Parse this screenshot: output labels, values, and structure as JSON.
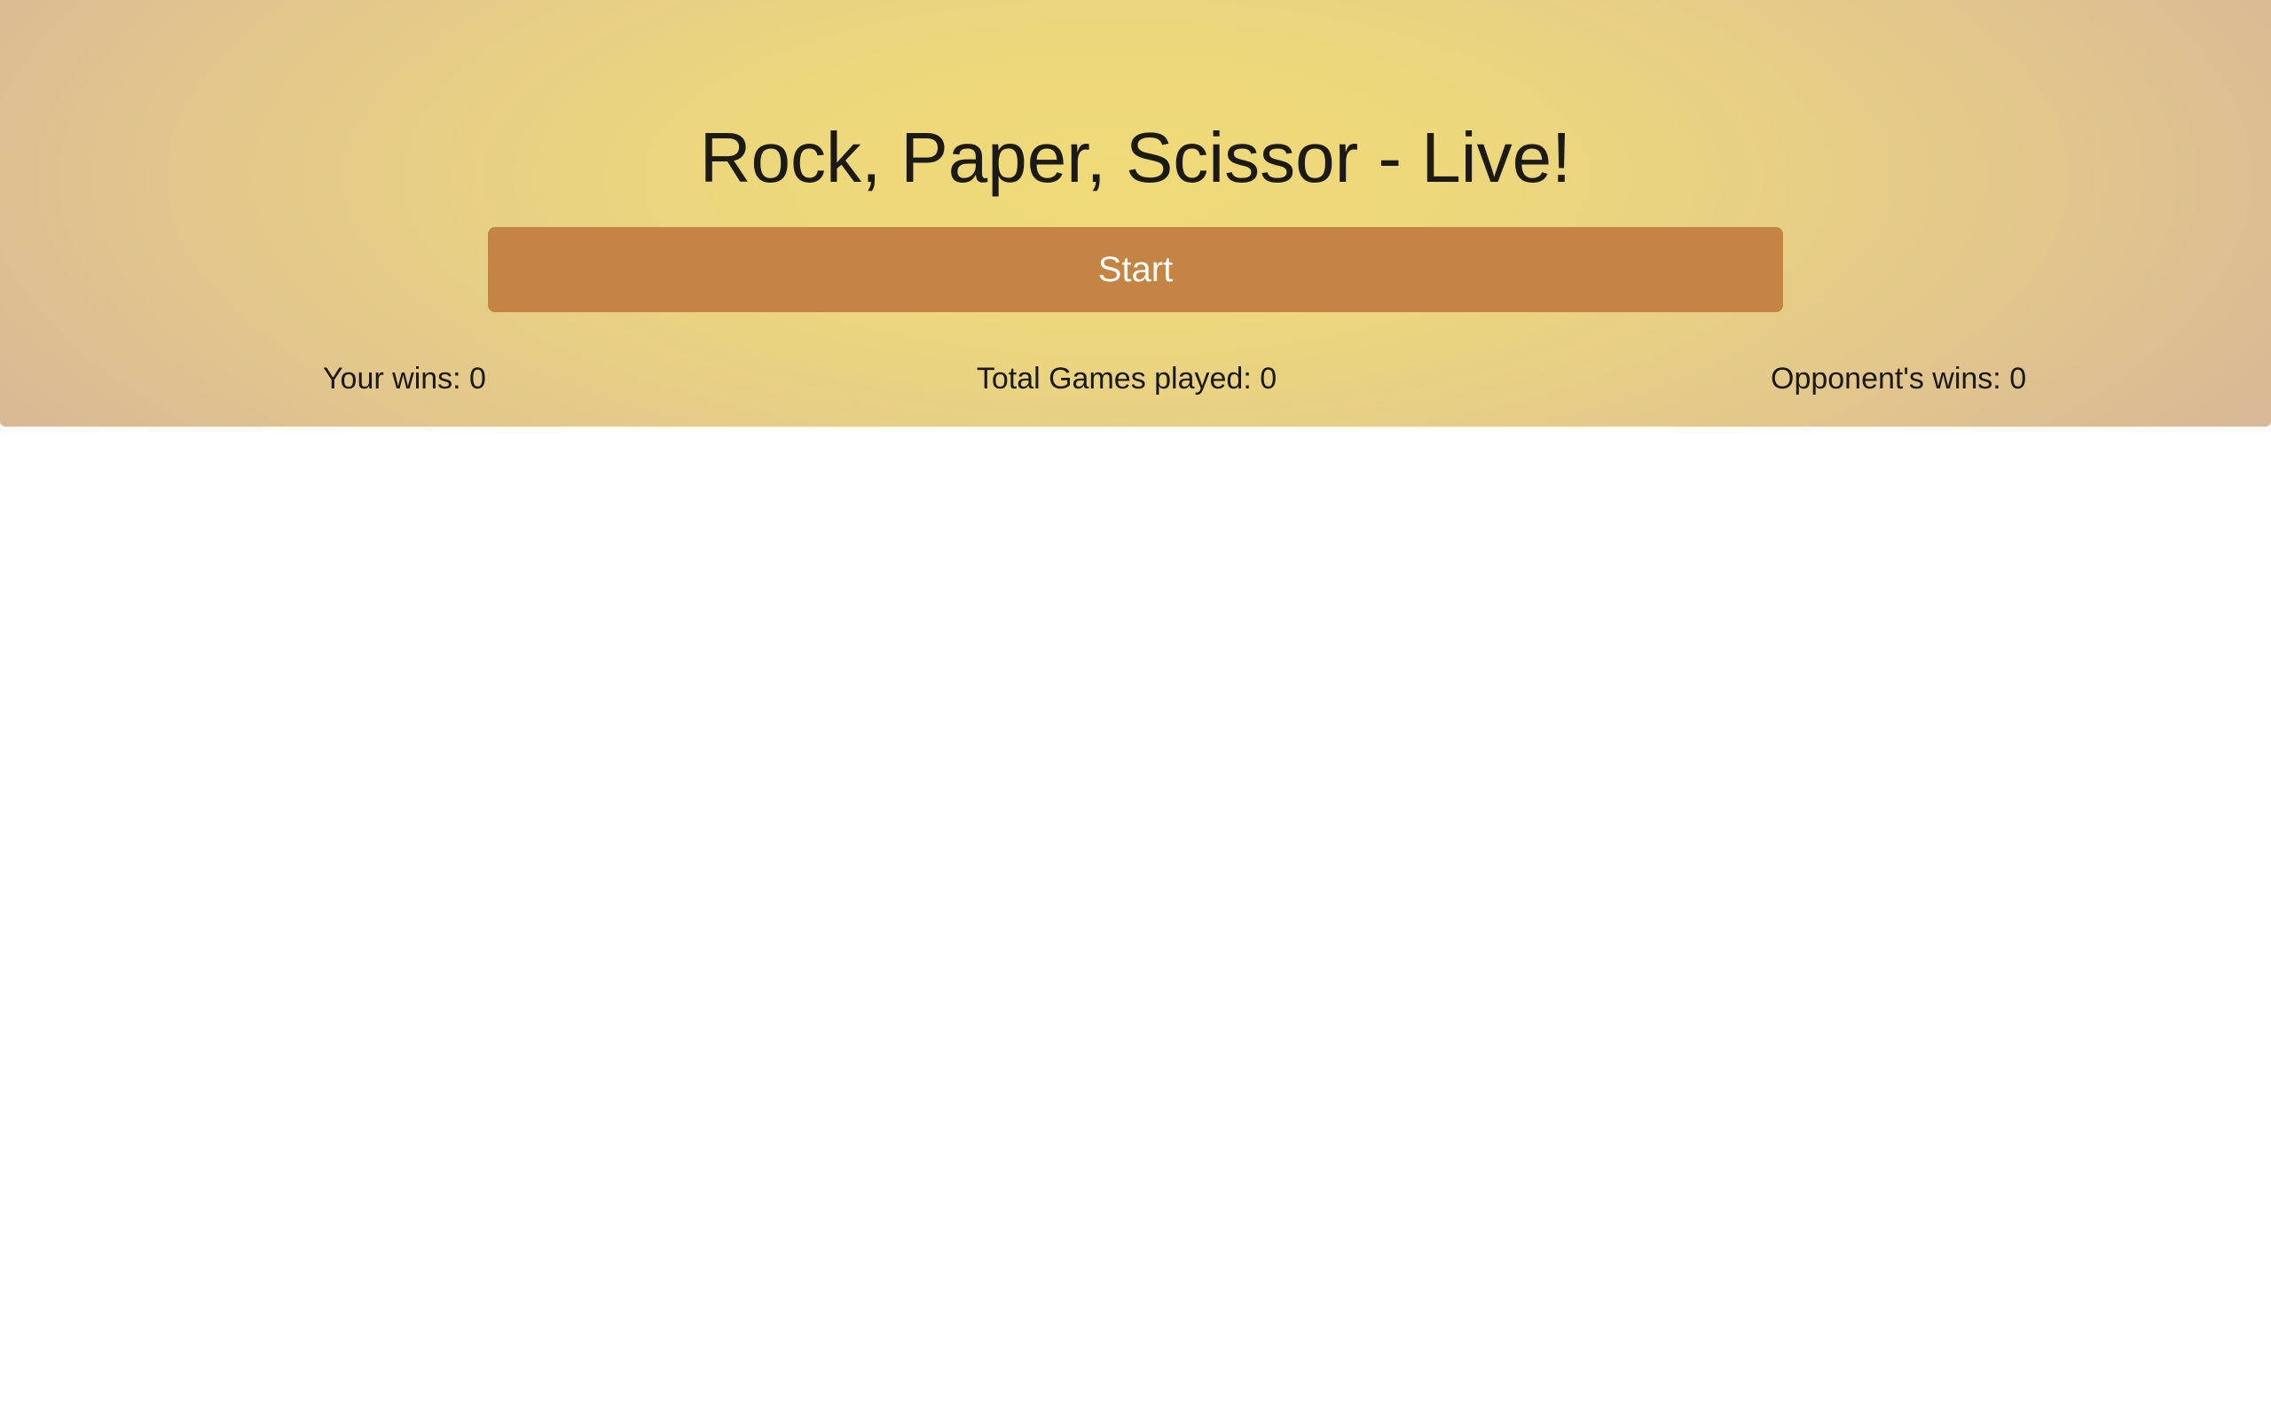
{
  "header": {
    "title": "Rock, Paper, Scissor - Live!",
    "start_label": "Start",
    "background_color": "#ecd77c",
    "button_color": "#c38444"
  },
  "stats": {
    "your_wins": "Your wins: 0",
    "total_games": "Total Games played: 0",
    "opponent_wins": "Opponent's wins: 0"
  }
}
